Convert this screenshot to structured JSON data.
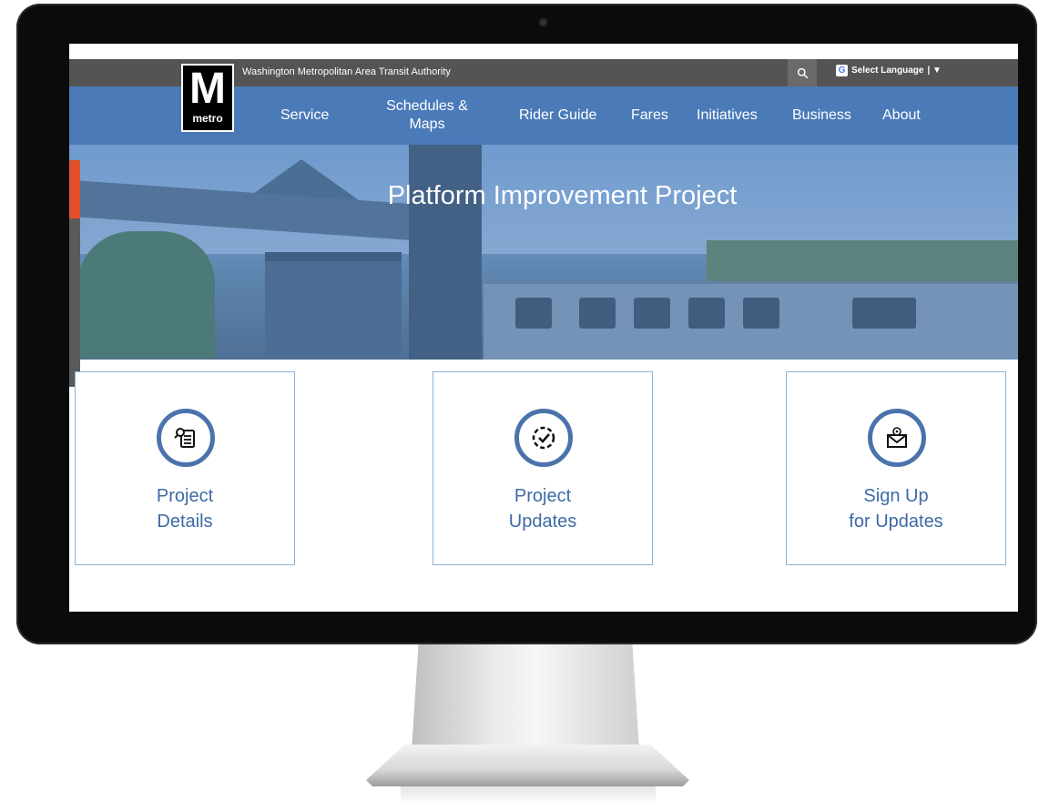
{
  "topbar": {
    "agency_name": "Washington Metropolitan Area Transit Authority",
    "language_label": "Select Language",
    "language_separator": "| ▼",
    "google_icon": "G"
  },
  "logo": {
    "letter": "M",
    "word": "metro"
  },
  "nav": {
    "items": [
      {
        "label": "Service"
      },
      {
        "label": "Schedules &",
        "label2": "Maps"
      },
      {
        "label": "Rider Guide"
      },
      {
        "label": "Fares"
      },
      {
        "label": "Initiatives"
      },
      {
        "label": "Business"
      },
      {
        "label": "About"
      }
    ]
  },
  "hero": {
    "title": "Platform Improvement Project"
  },
  "cards": [
    {
      "line1": "Project",
      "line2": "Details",
      "icon": "document-search-icon"
    },
    {
      "line1": "Project",
      "line2": "Updates",
      "icon": "check-circle-icon"
    },
    {
      "line1": "Sign Up",
      "line2": "for Updates",
      "icon": "email-envelope-icon"
    }
  ],
  "colors": {
    "nav_blue": "#4a7ab8",
    "topbar_grey": "#545454",
    "card_text_blue": "#3d6aa5",
    "side_red": "#e0502b"
  }
}
